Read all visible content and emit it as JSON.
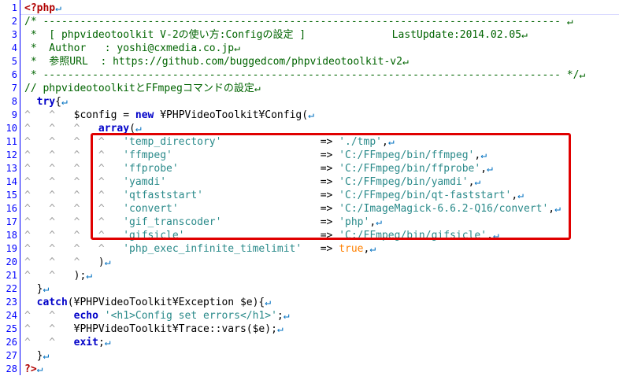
{
  "editor": {
    "lines": [
      {
        "n": "1",
        "tokens": [
          [
            "t-php",
            "<?php"
          ],
          [
            "t-nl",
            "↵"
          ]
        ]
      },
      {
        "n": "2",
        "tokens": [
          [
            "t-cm",
            "/* ------------------------------------------------------------------------------------ ↵"
          ]
        ]
      },
      {
        "n": "3",
        "tokens": [
          [
            "t-cm",
            " *  [ phpvideotoolkit V-2の使い方:Configの設定 ]              LastUpdate:2014.02.05↵"
          ]
        ]
      },
      {
        "n": "4",
        "tokens": [
          [
            "t-cm",
            " *  Author   : yoshi@cxmedia.co.jp↵"
          ]
        ]
      },
      {
        "n": "5",
        "tokens": [
          [
            "t-cm",
            " *  参照URL  : https://github.com/buggedcom/phpvideotoolkit-v2↵"
          ]
        ]
      },
      {
        "n": "6",
        "tokens": [
          [
            "t-cm",
            " * ------------------------------------------------------------------------------------ */↵"
          ]
        ]
      },
      {
        "n": "7",
        "tokens": [
          [
            "t-cm",
            "// phpvideotoolkitとFFmpegコマンドの設定↵"
          ]
        ]
      },
      {
        "n": "8",
        "tokens": [
          [
            "t-pl",
            "  "
          ],
          [
            "t-kw",
            "try"
          ],
          [
            "t-pl",
            "{"
          ],
          [
            "t-nl",
            "↵"
          ]
        ]
      },
      {
        "n": "9",
        "tokens": [
          [
            "guide",
            "^   ^   "
          ],
          [
            "t-pl",
            "$config = "
          ],
          [
            "t-kw",
            "new"
          ],
          [
            "t-pl",
            " ¥PHPVideoToolkit¥Config("
          ],
          [
            "t-nl",
            "↵"
          ]
        ]
      },
      {
        "n": "10",
        "tokens": [
          [
            "guide",
            "^   ^   ^   "
          ],
          [
            "t-kw",
            "array"
          ],
          [
            "t-pl",
            "("
          ],
          [
            "t-nl",
            "↵"
          ]
        ]
      },
      {
        "n": "11",
        "tokens": [
          [
            "guide",
            "^   ^   ^   ^   "
          ],
          [
            "t-str",
            "'temp_directory'"
          ],
          [
            "t-pl",
            "                => "
          ],
          [
            "t-str",
            "'./tmp'"
          ],
          [
            "t-pl",
            ","
          ],
          [
            "t-nl",
            "↵"
          ]
        ]
      },
      {
        "n": "12",
        "tokens": [
          [
            "guide",
            "^   ^   ^   ^   "
          ],
          [
            "t-str",
            "'ffmpeg'"
          ],
          [
            "t-pl",
            "                        => "
          ],
          [
            "t-str",
            "'C:/FFmpeg/bin/ffmpeg'"
          ],
          [
            "t-pl",
            ","
          ],
          [
            "t-nl",
            "↵"
          ]
        ]
      },
      {
        "n": "13",
        "tokens": [
          [
            "guide",
            "^   ^   ^   ^   "
          ],
          [
            "t-str",
            "'ffprobe'"
          ],
          [
            "t-pl",
            "                       => "
          ],
          [
            "t-str",
            "'C:/FFmpeg/bin/ffprobe'"
          ],
          [
            "t-pl",
            ","
          ],
          [
            "t-nl",
            "↵"
          ]
        ]
      },
      {
        "n": "14",
        "tokens": [
          [
            "guide",
            "^   ^   ^   ^   "
          ],
          [
            "t-str",
            "'yamdi'"
          ],
          [
            "t-pl",
            "                         => "
          ],
          [
            "t-str",
            "'C:/FFmpeg/bin/yamdi'"
          ],
          [
            "t-pl",
            ","
          ],
          [
            "t-nl",
            "↵"
          ]
        ]
      },
      {
        "n": "15",
        "tokens": [
          [
            "guide",
            "^   ^   ^   ^   "
          ],
          [
            "t-str",
            "'qtfaststart'"
          ],
          [
            "t-pl",
            "                   => "
          ],
          [
            "t-str",
            "'C:/FFmpeg/bin/qt-faststart'"
          ],
          [
            "t-pl",
            ","
          ],
          [
            "t-nl",
            "↵"
          ]
        ]
      },
      {
        "n": "16",
        "tokens": [
          [
            "guide",
            "^   ^   ^   ^   "
          ],
          [
            "t-str",
            "'convert'"
          ],
          [
            "t-pl",
            "                       => "
          ],
          [
            "t-str",
            "'C:/ImageMagick-6.6.2-Q16/convert'"
          ],
          [
            "t-pl",
            ","
          ],
          [
            "t-nl",
            "↵"
          ]
        ]
      },
      {
        "n": "17",
        "tokens": [
          [
            "guide",
            "^   ^   ^   ^   "
          ],
          [
            "t-str",
            "'gif_transcoder'"
          ],
          [
            "t-pl",
            "                => "
          ],
          [
            "t-str",
            "'php'"
          ],
          [
            "t-pl",
            ","
          ],
          [
            "t-nl",
            "↵"
          ]
        ]
      },
      {
        "n": "18",
        "tokens": [
          [
            "guide",
            "^   ^   ^   ^   "
          ],
          [
            "t-str",
            "'gifsicle'"
          ],
          [
            "t-pl",
            "                      => "
          ],
          [
            "t-str",
            "'C:/FFmpeg/bin/gifsicle'"
          ],
          [
            "t-pl",
            ","
          ],
          [
            "t-nl",
            "↵"
          ]
        ]
      },
      {
        "n": "19",
        "tokens": [
          [
            "guide",
            "^   ^   ^   ^   "
          ],
          [
            "t-str",
            "'php_exec_infinite_timelimit'"
          ],
          [
            "t-pl",
            "   => "
          ],
          [
            "t-bool",
            "true"
          ],
          [
            "t-pl",
            ","
          ],
          [
            "t-nl",
            "↵"
          ]
        ]
      },
      {
        "n": "20",
        "tokens": [
          [
            "guide",
            "^   ^   ^   "
          ],
          [
            "t-pl",
            ")"
          ],
          [
            "t-nl",
            "↵"
          ]
        ]
      },
      {
        "n": "21",
        "tokens": [
          [
            "guide",
            "^   ^   "
          ],
          [
            "t-pl",
            ");"
          ],
          [
            "t-nl",
            "↵"
          ]
        ]
      },
      {
        "n": "22",
        "tokens": [
          [
            "t-pl",
            "  }"
          ],
          [
            "t-nl",
            "↵"
          ]
        ]
      },
      {
        "n": "23",
        "tokens": [
          [
            "t-pl",
            "  "
          ],
          [
            "t-kw",
            "catch"
          ],
          [
            "t-pl",
            "(¥PHPVideoToolkit¥Exception $e){"
          ],
          [
            "t-nl",
            "↵"
          ]
        ]
      },
      {
        "n": "24",
        "tokens": [
          [
            "guide",
            "^   ^   "
          ],
          [
            "t-kw",
            "echo"
          ],
          [
            "t-pl",
            " "
          ],
          [
            "t-str",
            "'<h1>Config set errors</h1>'"
          ],
          [
            "t-pl",
            ";"
          ],
          [
            "t-nl",
            "↵"
          ]
        ]
      },
      {
        "n": "25",
        "tokens": [
          [
            "guide",
            "^   ^   "
          ],
          [
            "t-pl",
            "¥PHPVideoToolkit¥Trace::vars($e);"
          ],
          [
            "t-nl",
            "↵"
          ]
        ]
      },
      {
        "n": "26",
        "tokens": [
          [
            "guide",
            "^   ^   "
          ],
          [
            "t-kw",
            "exit"
          ],
          [
            "t-pl",
            ";"
          ],
          [
            "t-nl",
            "↵"
          ]
        ]
      },
      {
        "n": "27",
        "tokens": [
          [
            "t-pl",
            "  }"
          ],
          [
            "t-nl",
            "↵"
          ]
        ]
      },
      {
        "n": "28",
        "tokens": [
          [
            "t-php",
            "?>"
          ],
          [
            "t-nl",
            "↵"
          ]
        ]
      }
    ]
  },
  "colors": {
    "line_number": "#0000ff",
    "keyword": "#0000c8",
    "comment": "#006400",
    "string": "#2a8a8a",
    "highlight_border": "#e00000"
  }
}
